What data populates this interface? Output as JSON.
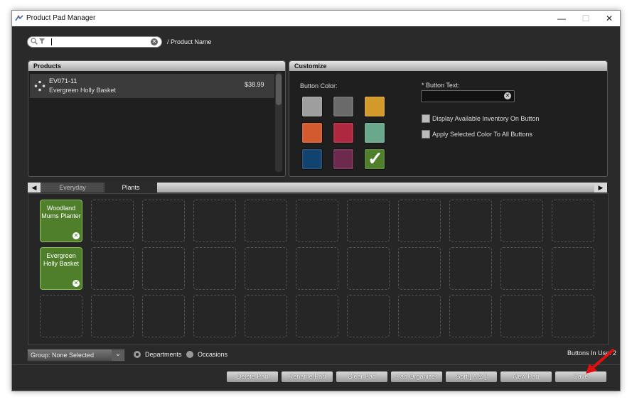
{
  "window": {
    "title": "Product Pad Manager",
    "min_glyph": "—",
    "max_glyph": "☐",
    "close_glyph": "✕"
  },
  "search": {
    "value": "",
    "placeholder": "",
    "clear_glyph": "✕"
  },
  "breadcrumb": "/ Product Name",
  "products": {
    "header": "Products",
    "items": [
      {
        "code": "EV071-11",
        "name": "Evergreen Holly Basket",
        "price": "$38.99"
      }
    ]
  },
  "customize": {
    "header": "Customize",
    "button_color_label": "Button Color:",
    "button_text_label": "* Button Text:",
    "button_text_value": "",
    "selected_mark": "✓",
    "clear_glyph": "✕",
    "swatches": [
      "#9e9e9e",
      "#6a6a6a",
      "#d39a2a",
      "#d25a2e",
      "#b0283f",
      "#6aa88c",
      "#12426f",
      "#6e2a4e",
      "#4f7f2a"
    ],
    "options": [
      {
        "label": "Display Available Inventory On Button",
        "checked": false
      },
      {
        "label": "Apply Selected Color To All Buttons",
        "checked": false
      }
    ]
  },
  "tabs": {
    "left_glyph": "◀",
    "right_glyph": "▶",
    "items": [
      "Everyday",
      "Plants"
    ]
  },
  "pad": {
    "buttons": [
      {
        "label": "Woodland Mums Planter",
        "color": "#4f7f2a"
      },
      {
        "label": "Evergreen Holly Basket",
        "color": "#4f7f2a"
      }
    ],
    "remove_glyph": "✕"
  },
  "footer": {
    "group_value": "Group: None Selected",
    "dropdown_glyph": "⌄",
    "radio_departments": "Departments",
    "radio_occasions": "Occasions",
    "buttons_in_use": "Buttons In Use: 2",
    "actions": [
      "Delete Pad",
      "Rename Pad",
      "Clear Pad",
      "Pad Organizer",
      "Sort [ A-Z ]",
      "New Pad",
      "Save"
    ]
  }
}
